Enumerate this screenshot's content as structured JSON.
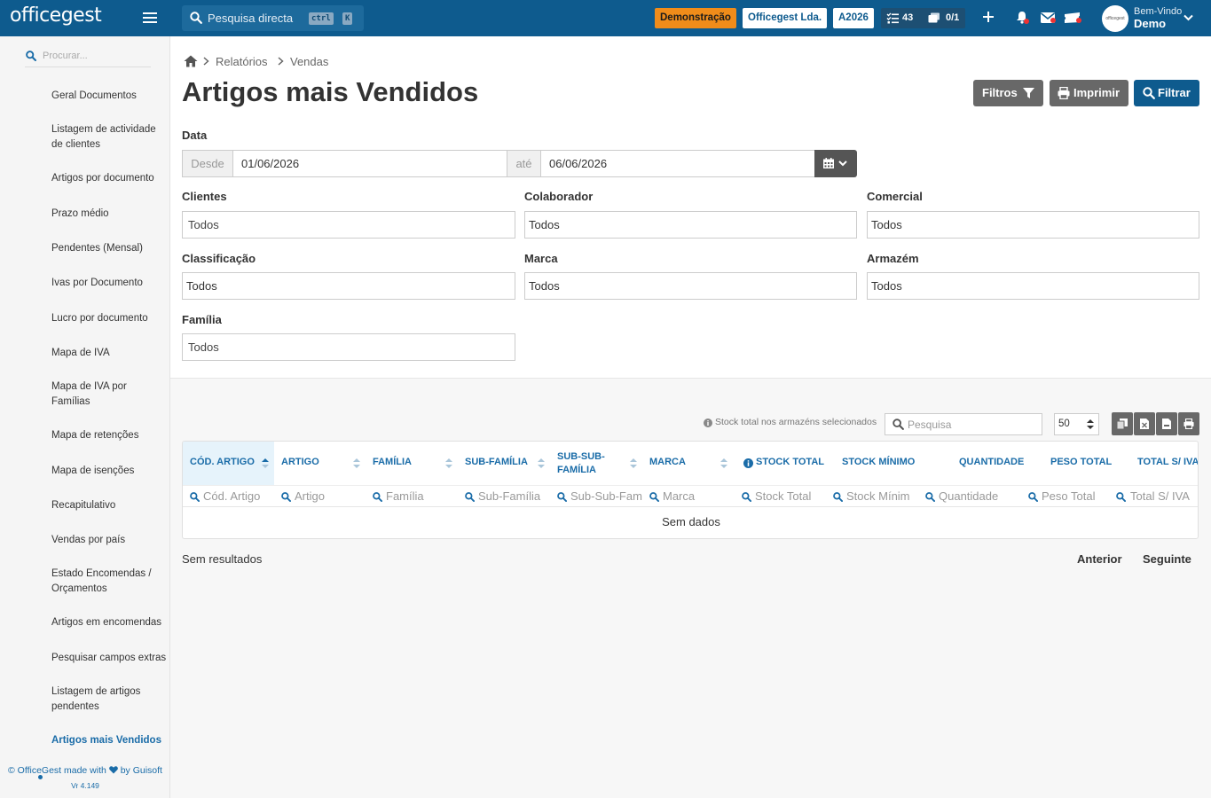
{
  "topbar": {
    "logo": "officegest",
    "search_label": "Pesquisa directa",
    "kbd_ctrl": "ctrl",
    "kbd_k": "K",
    "demo_badge": "Demonstração",
    "company_badge": "Officegest Lda.",
    "year_badge": "A2026",
    "tasks_count": "43",
    "docs_count": "0/1",
    "welcome": "Bem-Vindo",
    "user_name": "Demo",
    "colors": {
      "bar": "#0e5b8e",
      "demo": "#f08c1a"
    },
    "icons": [
      "search-icon",
      "tasks-icon",
      "documents-icon",
      "plus-icon",
      "bell-icon",
      "mail-icon",
      "ticket-icon",
      "chevron-down-icon"
    ]
  },
  "sidebar": {
    "search_placeholder": "Procurar...",
    "items": [
      {
        "label": "Geral Documentos"
      },
      {
        "label": "Listagem de actividade de clientes"
      },
      {
        "label": "Artigos por documento"
      },
      {
        "label": "Prazo médio"
      },
      {
        "label": "Pendentes (Mensal)"
      },
      {
        "label": "Ivas por Documento"
      },
      {
        "label": "Lucro por documento"
      },
      {
        "label": "Mapa de IVA"
      },
      {
        "label": "Mapa de IVA por Famílias"
      },
      {
        "label": "Mapa de retenções"
      },
      {
        "label": "Mapa de isenções"
      },
      {
        "label": "Recapitulativo"
      },
      {
        "label": "Vendas por país"
      },
      {
        "label": "Estado Encomendas / Orçamentos"
      },
      {
        "label": "Artigos em encomendas"
      },
      {
        "label": "Pesquisar campos extras"
      },
      {
        "label": "Listagem de artigos pendentes"
      },
      {
        "label": "Artigos mais Vendidos",
        "active": true
      }
    ],
    "footer_prefix": "© OfficeGest made with",
    "footer_suffix": "by Guisoft",
    "version": "Vr 4.149"
  },
  "breadcrumb": {
    "items": [
      "Relatórios",
      "Vendas"
    ]
  },
  "page": {
    "title": "Artigos mais Vendidos",
    "buttons": {
      "filters": "Filtros",
      "print": "Imprimir",
      "filter": "Filtrar"
    }
  },
  "filters": {
    "date_label": "Data",
    "from_label": "Desde",
    "from_value": "01/06/2026",
    "to_label": "até",
    "to_value": "06/06/2026",
    "fields": [
      {
        "label": "Clientes",
        "value": "Todos"
      },
      {
        "label": "Colaborador",
        "value": "Todos"
      },
      {
        "label": "Comercial",
        "value": "Todos"
      },
      {
        "label": "Classificação",
        "value": "Todos"
      },
      {
        "label": "Marca",
        "value": "Todos"
      },
      {
        "label": "Armazém",
        "value": "Todos"
      },
      {
        "label": "Família",
        "value": "Todos"
      }
    ]
  },
  "table": {
    "stock_note": "Stock total nos armazéns selecionados",
    "search_placeholder": "Pesquisa",
    "page_size": "50",
    "columns": [
      {
        "label": "CÓD. ARTIGO",
        "filter": "Cód. Artigo"
      },
      {
        "label": "ARTIGO",
        "filter": "Artigo"
      },
      {
        "label": "FAMÍLIA",
        "filter": "Família"
      },
      {
        "label": "SUB-FAMÍLIA",
        "filter": "Sub-Família"
      },
      {
        "label": "SUB-SUB-FAMÍLIA",
        "filter": "Sub-Sub-Fam"
      },
      {
        "label": "MARCA",
        "filter": "Marca"
      },
      {
        "label": "STOCK TOTAL",
        "filter": "Stock Total"
      },
      {
        "label": "STOCK MÍNIMO",
        "filter": "Stock Mínim"
      },
      {
        "label": "QUANTIDADE",
        "filter": "Quantidade"
      },
      {
        "label": "PESO TOTAL",
        "filter": "Peso Total"
      },
      {
        "label": "TOTAL S/ IVA",
        "filter": "Total S/ IVA"
      }
    ],
    "empty_text": "Sem dados",
    "no_results": "Sem resultados",
    "prev": "Anterior",
    "next": "Seguinte"
  }
}
